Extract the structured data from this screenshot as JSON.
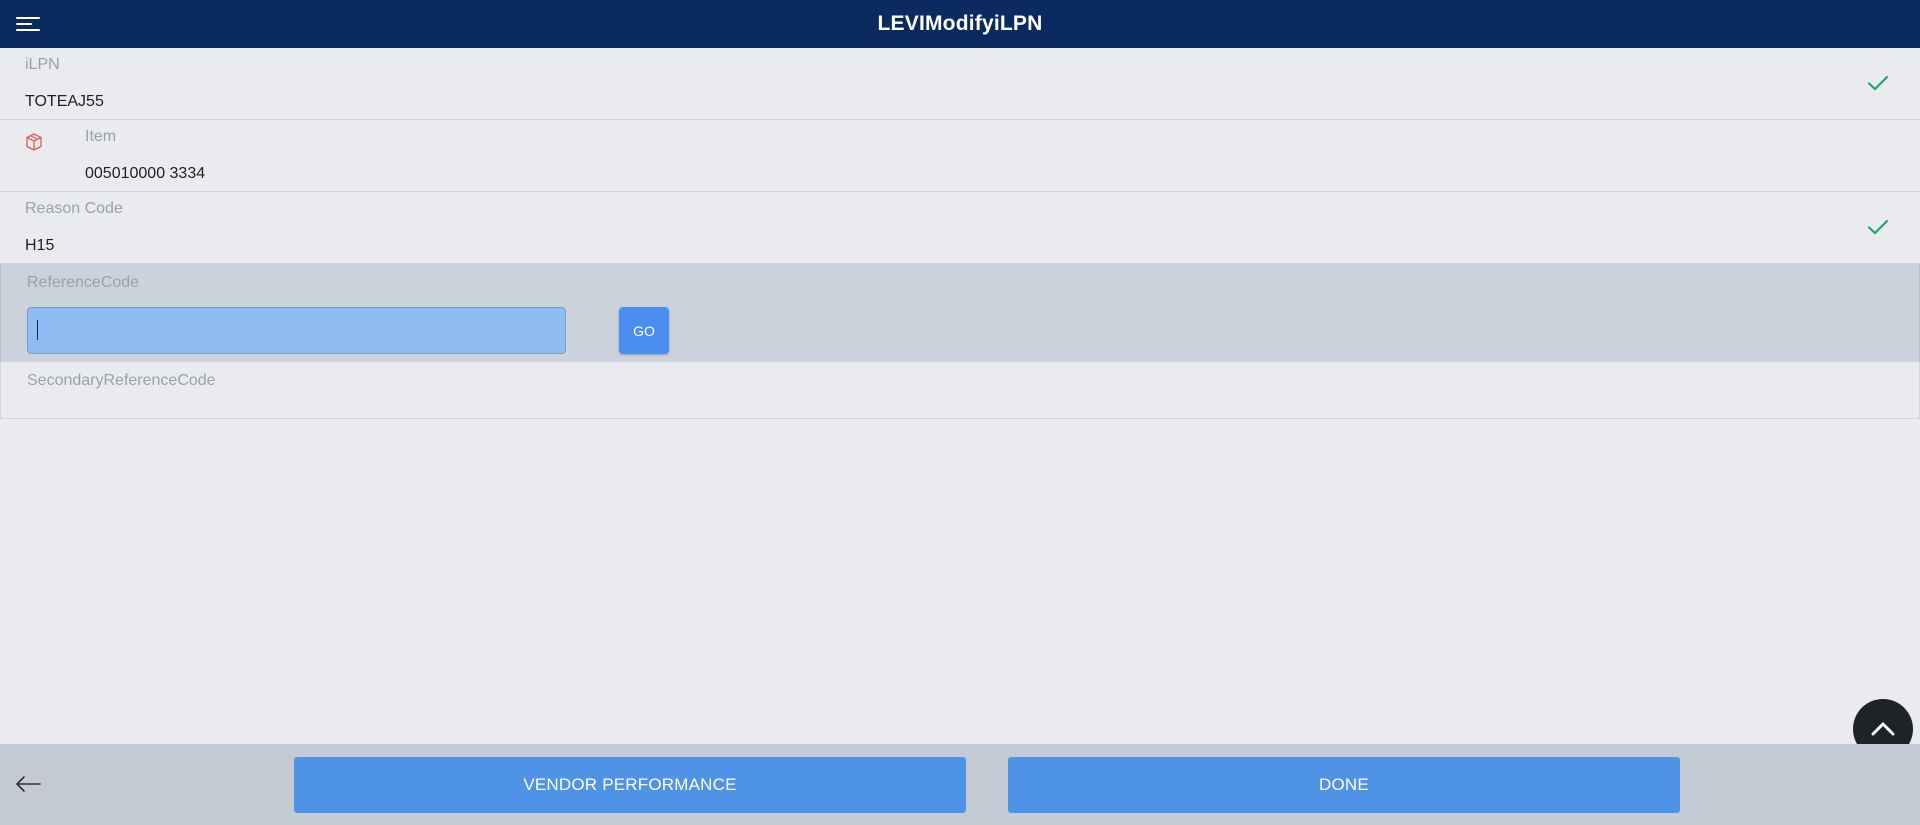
{
  "header": {
    "title": "LEVIModifyiLPN",
    "menu_icon": "hamburger-menu-icon"
  },
  "fields": {
    "ilpn": {
      "label": "iLPN",
      "value": "TOTEAJ55",
      "status_icon": "check-icon"
    },
    "item": {
      "label": "Item",
      "value": "005010000 3334",
      "icon": "package-icon"
    },
    "reason": {
      "label": "Reason Code",
      "value": "H15",
      "status_icon": "check-icon"
    },
    "reference": {
      "label": "ReferenceCode",
      "value": "",
      "go_label": "GO"
    },
    "secondary": {
      "label": "SecondaryReferenceCode"
    }
  },
  "footer": {
    "back_icon": "arrow-left-icon",
    "vendor_label": "VENDOR PERFORMANCE",
    "done_label": "DONE"
  },
  "colors": {
    "header_bg": "#0b2a5f",
    "check_green": "#1aa66a",
    "button_blue": "#4f93e6",
    "input_active": "#8fbdf3",
    "item_icon_red": "#e45a5a"
  }
}
